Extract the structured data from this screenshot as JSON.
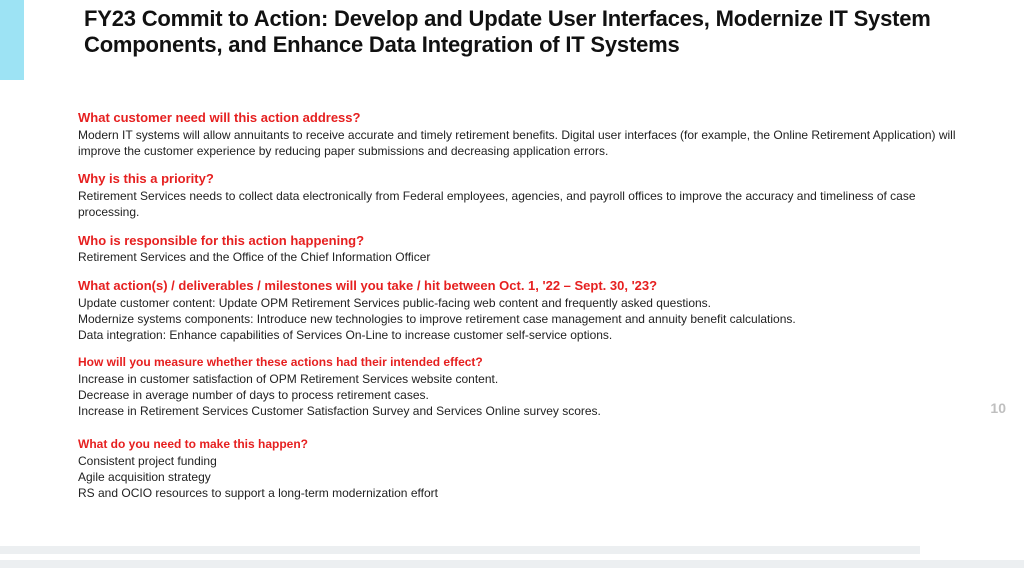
{
  "title": "FY23 Commit to Action: Develop and Update User Interfaces, Modernize IT System Components, and Enhance Data Integration of IT Systems",
  "page_number": "10",
  "sections": {
    "s1": {
      "q": "What customer need will this action address?",
      "a1": "Modern IT systems will allow annuitants to receive accurate and timely retirement benefits. Digital user interfaces (for example, the Online Retirement Application) will improve the customer experience by reducing paper submissions and decreasing application errors."
    },
    "s2": {
      "q": "Why is this a priority?",
      "a1": "Retirement Services needs to collect data electronically from Federal employees, agencies, and payroll offices to improve the accuracy and timeliness of case processing."
    },
    "s3": {
      "q": "Who is responsible for this action happening?",
      "a1": "Retirement Services and the Office of the Chief Information Officer"
    },
    "s4": {
      "q": "What action(s) / deliverables / milestones will you take / hit between Oct. 1, '22 – Sept. 30, '23?",
      "a1": "Update customer content: Update OPM Retirement Services public-facing web content and frequently asked questions.",
      "a2": "Modernize systems components: Introduce new technologies to improve retirement case management and annuity benefit calculations.",
      "a3": "Data integration: Enhance capabilities of Services On-Line to increase customer self-service options."
    },
    "s5": {
      "q": "How will you measure whether these actions had their intended effect?",
      "a1": "Increase in customer satisfaction of OPM Retirement Services website content.",
      "a2": "Decrease in average number of days to process retirement cases.",
      "a3": "Increase in Retirement Services Customer Satisfaction Survey and Services Online survey scores."
    },
    "s6": {
      "q": "What do you need to make this happen?",
      "a1": "Consistent project funding",
      "a2": "Agile acquisition strategy",
      "a3": "RS and OCIO resources to support a long-term modernization effort"
    }
  }
}
